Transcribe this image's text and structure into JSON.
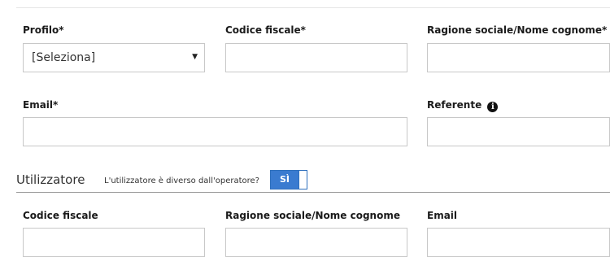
{
  "operator": {
    "profilo_label": "Profilo*",
    "profilo_value": "[Seleziona]",
    "codice_fiscale_label": "Codice fiscale*",
    "ragione_sociale_label": "Ragione sociale/Nome cognome*",
    "email_label": "Email*",
    "referente_label": "Referente"
  },
  "utilizzatore": {
    "title": "Utilizzatore",
    "question": "L'utilizzatore è diverso dall'operatore?",
    "toggle_label": "SÌ",
    "codice_fiscale_label": "Codice fiscale",
    "ragione_sociale_label": "Ragione sociale/Nome cognome",
    "email_label": "Email"
  },
  "colors": {
    "toggle": "#3a7bd0"
  },
  "icons": {
    "referente_info": "info-circle-icon",
    "profilo_dropdown": "caret-down-icon"
  }
}
